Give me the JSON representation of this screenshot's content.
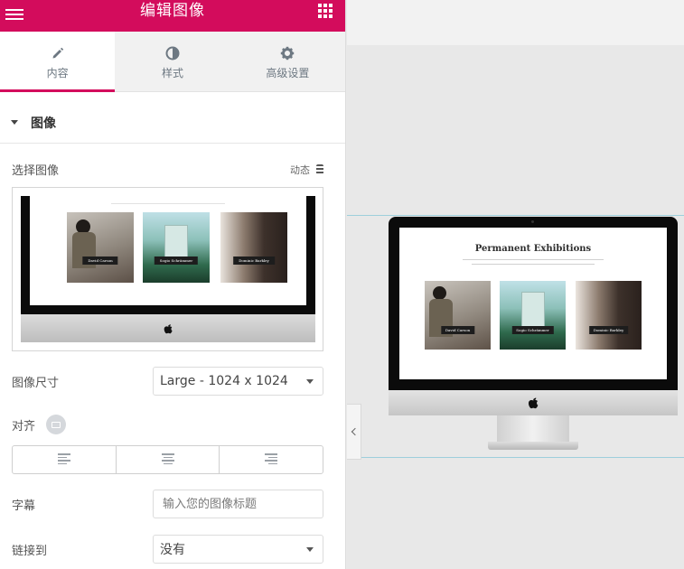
{
  "header": {
    "title": "编辑图像",
    "menu_icon": "hamburger-icon",
    "apps_icon": "grid-icon"
  },
  "tabs": [
    {
      "label": "内容",
      "icon": "pencil-icon",
      "active": true
    },
    {
      "label": "样式",
      "icon": "contrast-icon",
      "active": false
    },
    {
      "label": "高级设置",
      "icon": "gear-icon",
      "active": false
    }
  ],
  "section": {
    "title": "图像"
  },
  "choose_image": {
    "label": "选择图像",
    "dynamic_label": "动态"
  },
  "image_size": {
    "label": "图像尺寸",
    "value": "Large - 1024 x 1024"
  },
  "alignment": {
    "label": "对齐"
  },
  "caption": {
    "label": "字幕",
    "placeholder": "输入您的图像标题"
  },
  "link": {
    "label": "链接到",
    "value": "没有"
  },
  "preview": {
    "title": "Permanent Exhibitions",
    "cards": [
      "David Carson",
      "Sogio Schrämmer",
      "Dominic Barkley"
    ]
  },
  "colors": {
    "accent": "#d30c5c",
    "panel_bg": "#ffffff",
    "canvas_bg": "#e8e8e8"
  }
}
